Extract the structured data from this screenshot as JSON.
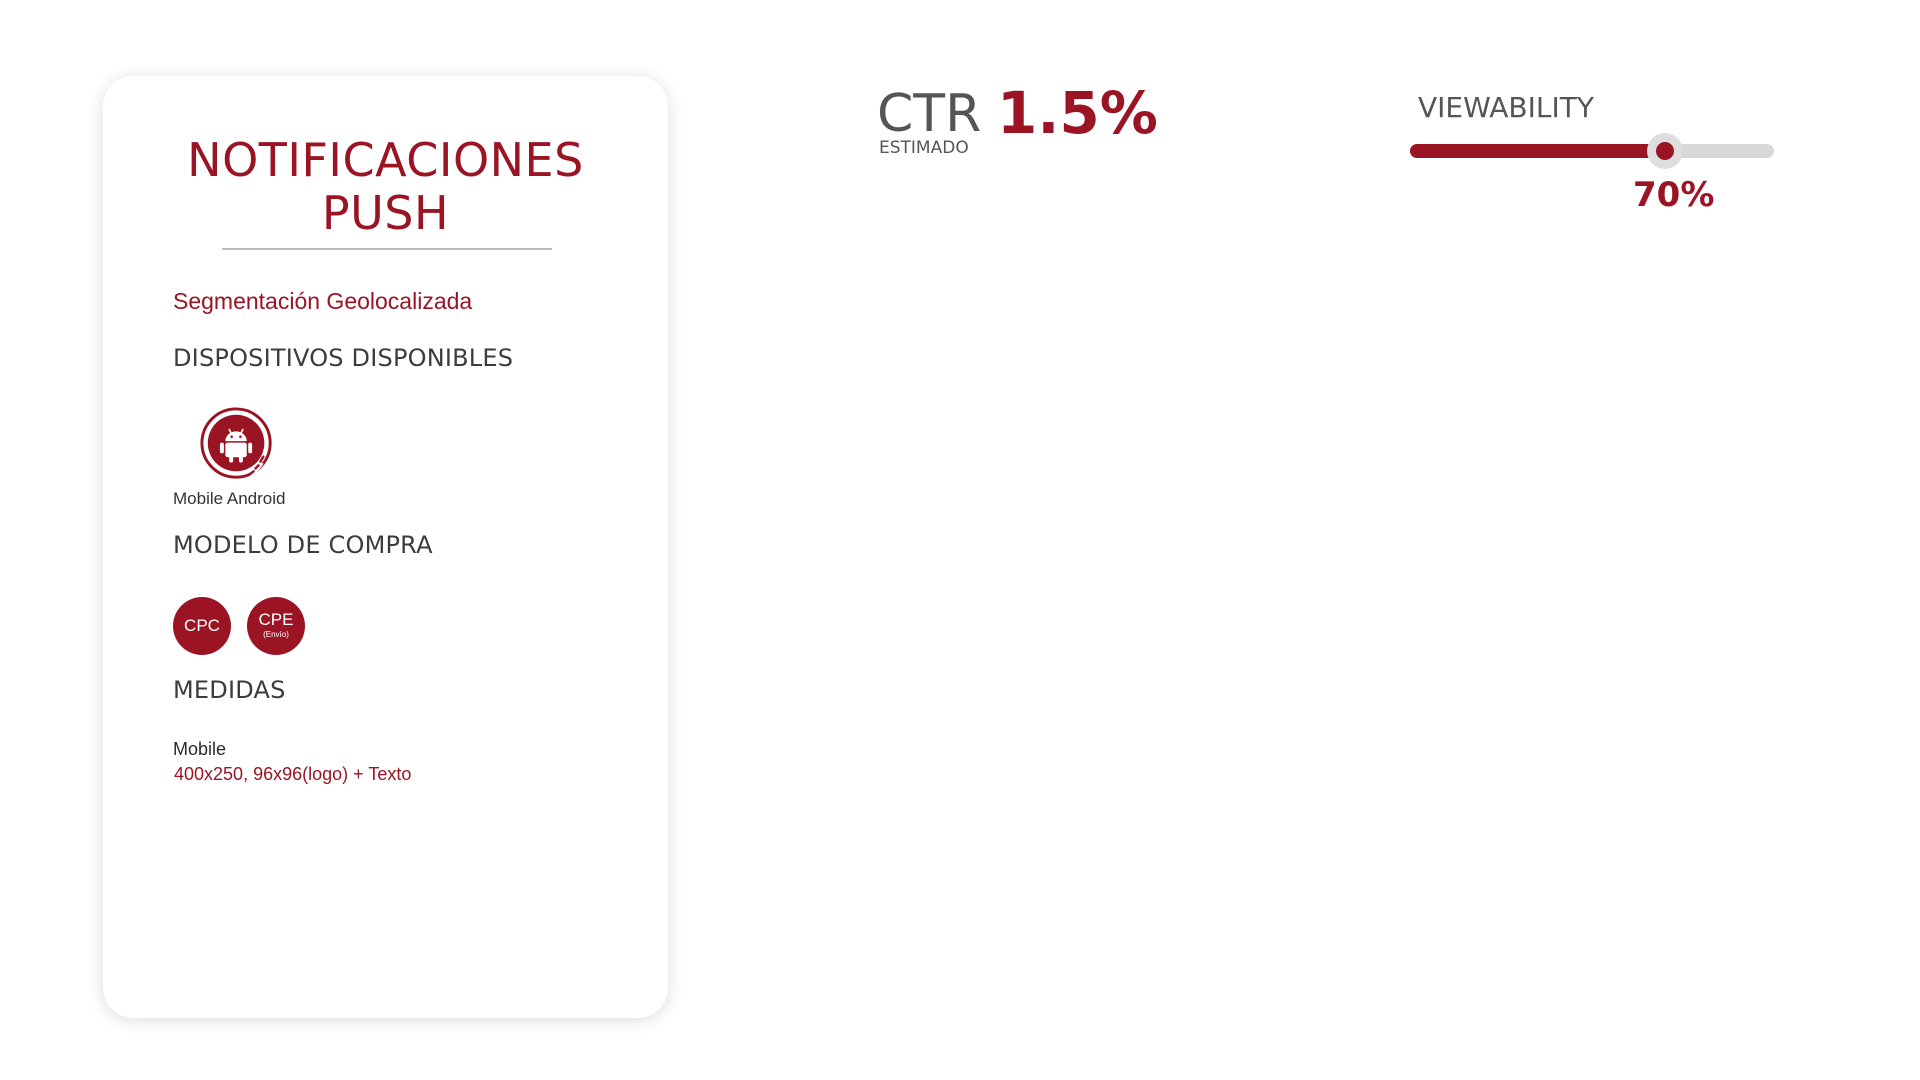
{
  "card": {
    "title_line1": "NOTIFICACIONES",
    "title_line2": "PUSH",
    "segmentation": "Segmentación Geolocalizada",
    "devices_heading": "DISPOSITIVOS DISPONIBLES",
    "devices": [
      {
        "label": "Mobile Android",
        "icon": "android-icon"
      }
    ],
    "purchase_heading": "MODELO DE COMPRA",
    "purchase_models": [
      {
        "label": "CPC",
        "sublabel": ""
      },
      {
        "label": "CPE",
        "sublabel": "(Envío)"
      }
    ],
    "measures_heading": "MEDIDAS",
    "measures": [
      {
        "platform": "Mobile",
        "value": "400x250, 96x96(logo) + Texto"
      }
    ]
  },
  "ctr": {
    "label": "CTR",
    "sublabel": "ESTIMADO",
    "value": "1.5%"
  },
  "viewability": {
    "label": "VIEWABILITY",
    "value_text": "70%",
    "fraction": 0.7
  },
  "colors": {
    "brand": "#9a1424",
    "text_gray": "#555555",
    "track": "#d8d8d8"
  }
}
